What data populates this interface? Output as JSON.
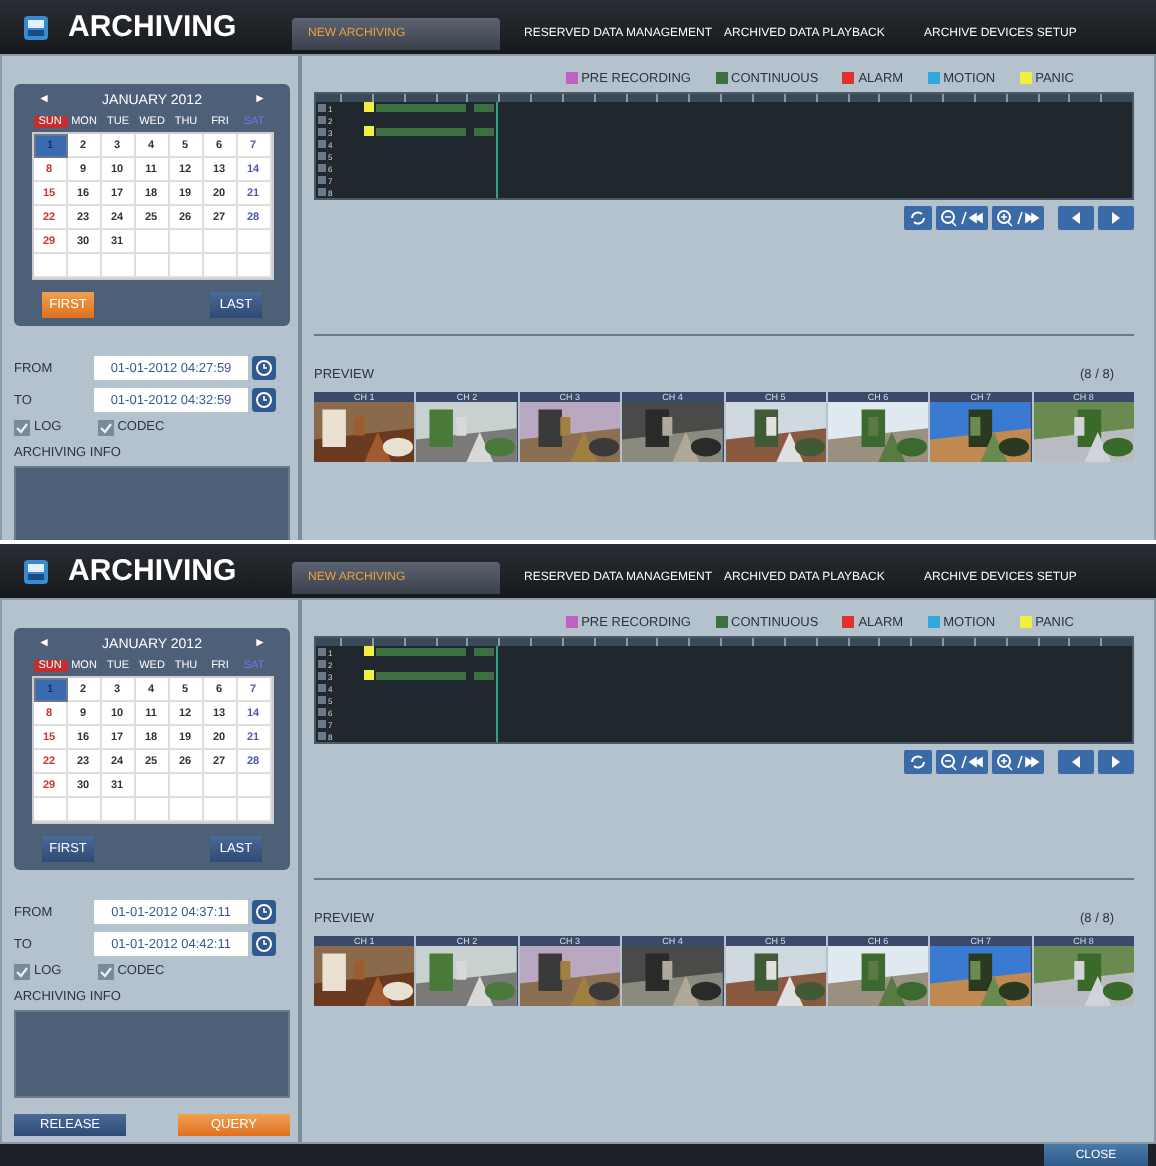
{
  "screens": [
    {
      "title": "ARCHIVING",
      "tabs": [
        {
          "label": "NEW ARCHIVING",
          "selected": true
        },
        {
          "label": "RESERVED DATA MANAGEMENT",
          "selected": false
        },
        {
          "label": "ARCHIVED DATA PLAYBACK",
          "selected": false
        },
        {
          "label": "ARCHIVE DEVICES SETUP",
          "selected": false
        }
      ],
      "calendar": {
        "prev": "◄",
        "month": "JANUARY 2012",
        "next": "►",
        "weekdays": [
          "SUN",
          "MON",
          "TUE",
          "WED",
          "THU",
          "FRI",
          "SAT"
        ],
        "days": [
          {
            "label": "1",
            "selected": true
          },
          {
            "label": "2",
            "selected": false
          },
          {
            "label": "3",
            "selected": false
          },
          {
            "label": "4",
            "selected": false
          },
          {
            "label": "5",
            "selected": false
          },
          {
            "label": "6",
            "selected": false
          },
          {
            "label": "7",
            "selected": false
          },
          {
            "label": "8",
            "selected": false
          },
          {
            "label": "9",
            "selected": false
          },
          {
            "label": "10",
            "selected": false
          },
          {
            "label": "11",
            "selected": false
          },
          {
            "label": "12",
            "selected": false
          },
          {
            "label": "13",
            "selected": false
          },
          {
            "label": "14",
            "selected": false
          },
          {
            "label": "15",
            "selected": false
          },
          {
            "label": "16",
            "selected": false
          },
          {
            "label": "17",
            "selected": false
          },
          {
            "label": "18",
            "selected": false
          },
          {
            "label": "19",
            "selected": false
          },
          {
            "label": "20",
            "selected": false
          },
          {
            "label": "21",
            "selected": false
          },
          {
            "label": "22",
            "selected": false
          },
          {
            "label": "23",
            "selected": false
          },
          {
            "label": "24",
            "selected": false
          },
          {
            "label": "25",
            "selected": false
          },
          {
            "label": "26",
            "selected": false
          },
          {
            "label": "27",
            "selected": false
          },
          {
            "label": "28",
            "selected": false
          },
          {
            "label": "29",
            "selected": false
          },
          {
            "label": "30",
            "selected": false
          },
          {
            "label": "31",
            "selected": false
          }
        ],
        "buttons": [
          {
            "label": "FIRST",
            "selected": true
          },
          {
            "label": "LAST",
            "selected": false
          }
        ]
      },
      "from": {
        "label": "FROM",
        "value": "01-01-2012 04:27:59"
      },
      "to": {
        "label": "TO",
        "value": "01-01-2012 04:32:59"
      },
      "checks": [
        {
          "label": "LOG",
          "checked": true
        },
        {
          "label": "CODEC",
          "checked": true
        }
      ],
      "info_label": "ARCHIVING INFO",
      "legend": [
        {
          "label": "PRE RECORDING",
          "color": "#c060c0"
        },
        {
          "label": "CONTINUOUS",
          "color": "#3c7040"
        },
        {
          "label": "ALARM",
          "color": "#e03030"
        },
        {
          "label": "MOTION",
          "color": "#30a8e0"
        },
        {
          "label": "PANIC",
          "color": "#f0f040"
        }
      ],
      "channels": [
        {
          "label": "1",
          "recording": true
        },
        {
          "label": "2",
          "recording": false
        },
        {
          "label": "3",
          "recording": true
        },
        {
          "label": "4",
          "recording": false
        },
        {
          "label": "5",
          "recording": false
        },
        {
          "label": "6",
          "recording": false
        },
        {
          "label": "7",
          "recording": false
        },
        {
          "label": "8",
          "recording": false
        }
      ],
      "preview": {
        "label": "PREVIEW",
        "count": "(8 / 8)",
        "cameras": [
          "CH 1",
          "CH 2",
          "CH 3",
          "CH 4",
          "CH 5",
          "CH 6",
          "CH 7",
          "CH 8"
        ]
      }
    },
    {
      "title": "ARCHIVING",
      "tabs": [
        {
          "label": "NEW ARCHIVING",
          "selected": true
        },
        {
          "label": "RESERVED DATA MANAGEMENT",
          "selected": false
        },
        {
          "label": "ARCHIVED DATA PLAYBACK",
          "selected": false
        },
        {
          "label": "ARCHIVE DEVICES SETUP",
          "selected": false
        }
      ],
      "calendar": {
        "prev": "◄",
        "month": "JANUARY 2012",
        "next": "►",
        "weekdays": [
          "SUN",
          "MON",
          "TUE",
          "WED",
          "THU",
          "FRI",
          "SAT"
        ],
        "days": [
          {
            "label": "1",
            "selected": true
          },
          {
            "label": "2",
            "selected": false
          },
          {
            "label": "3",
            "selected": false
          },
          {
            "label": "4",
            "selected": false
          },
          {
            "label": "5",
            "selected": false
          },
          {
            "label": "6",
            "selected": false
          },
          {
            "label": "7",
            "selected": false
          },
          {
            "label": "8",
            "selected": false
          },
          {
            "label": "9",
            "selected": false
          },
          {
            "label": "10",
            "selected": false
          },
          {
            "label": "11",
            "selected": false
          },
          {
            "label": "12",
            "selected": false
          },
          {
            "label": "13",
            "selected": false
          },
          {
            "label": "14",
            "selected": false
          },
          {
            "label": "15",
            "selected": false
          },
          {
            "label": "16",
            "selected": false
          },
          {
            "label": "17",
            "selected": false
          },
          {
            "label": "18",
            "selected": false
          },
          {
            "label": "19",
            "selected": false
          },
          {
            "label": "20",
            "selected": false
          },
          {
            "label": "21",
            "selected": false
          },
          {
            "label": "22",
            "selected": false
          },
          {
            "label": "23",
            "selected": false
          },
          {
            "label": "24",
            "selected": false
          },
          {
            "label": "25",
            "selected": false
          },
          {
            "label": "26",
            "selected": false
          },
          {
            "label": "27",
            "selected": false
          },
          {
            "label": "28",
            "selected": false
          },
          {
            "label": "29",
            "selected": false
          },
          {
            "label": "30",
            "selected": false
          },
          {
            "label": "31",
            "selected": false
          }
        ],
        "buttons": [
          {
            "label": "FIRST",
            "selected": false
          },
          {
            "label": "LAST",
            "selected": false
          }
        ]
      },
      "from": {
        "label": "FROM",
        "value": "01-01-2012 04:37:11"
      },
      "to": {
        "label": "TO",
        "value": "01-01-2012 04:42:11"
      },
      "checks": [
        {
          "label": "LOG",
          "checked": true
        },
        {
          "label": "CODEC",
          "checked": true
        }
      ],
      "info_label": "ARCHIVING INFO",
      "actions": [
        {
          "label": "RELEASE",
          "selected": false
        },
        {
          "label": "QUERY",
          "selected": true
        }
      ],
      "legend": [
        {
          "label": "PRE RECORDING",
          "color": "#c060c0"
        },
        {
          "label": "CONTINUOUS",
          "color": "#3c7040"
        },
        {
          "label": "ALARM",
          "color": "#e03030"
        },
        {
          "label": "MOTION",
          "color": "#30a8e0"
        },
        {
          "label": "PANIC",
          "color": "#f0f040"
        }
      ],
      "channels": [
        {
          "label": "1",
          "recording": true
        },
        {
          "label": "2",
          "recording": false
        },
        {
          "label": "3",
          "recording": true
        },
        {
          "label": "4",
          "recording": false
        },
        {
          "label": "5",
          "recording": false
        },
        {
          "label": "6",
          "recording": false
        },
        {
          "label": "7",
          "recording": false
        },
        {
          "label": "8",
          "recording": false
        }
      ],
      "preview": {
        "label": "PREVIEW",
        "count": "(8 / 8)",
        "cameras": [
          "CH 1",
          "CH 2",
          "CH 3",
          "CH 4",
          "CH 5",
          "CH 6",
          "CH 7",
          "CH 8"
        ]
      }
    }
  ],
  "footer": {
    "close": "CLOSE"
  }
}
